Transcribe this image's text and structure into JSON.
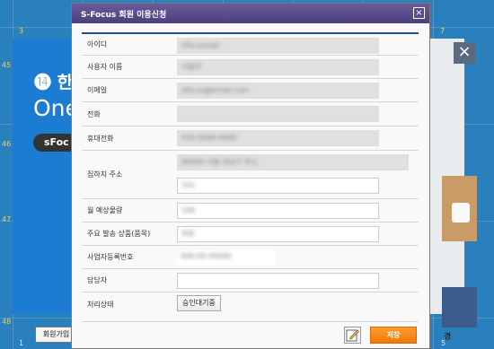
{
  "calendar": {
    "day_numbers": [
      "3",
      "7",
      "45",
      "46",
      "47",
      "48",
      "1",
      "5"
    ]
  },
  "ad": {
    "logo_text": "한",
    "headline": "One",
    "pill": "sFoc",
    "close_icon": "×",
    "join_button": "회원가입",
    "right_text": "경"
  },
  "dialog": {
    "title": "S-Focus 회원 이용신청",
    "close_icon": "×",
    "fields": {
      "userid": {
        "label": "아이디",
        "value": "sfocususer"
      },
      "username": {
        "label": "사용자 이름",
        "value": "사용자"
      },
      "email": {
        "label": "이메일",
        "value": "sfocus@email.com"
      },
      "phone": {
        "label": "전화",
        "value": ""
      },
      "mobile": {
        "label": "휴대전화",
        "value": "010-0000-0000"
      },
      "address": {
        "label": "집하지 주소",
        "value1": "00000 서울 강남구 주소",
        "value2": "101"
      },
      "monthly": {
        "label": "월 예상물량",
        "value": "100"
      },
      "product": {
        "label": "주요 발송 상품(품목)",
        "value": "의류"
      },
      "bizno": {
        "label": "사업자등록번호",
        "value": "000-00-00000"
      },
      "manager": {
        "label": "담당자",
        "value": ""
      },
      "status": {
        "label": "처리상태",
        "value": "승인대기중"
      }
    },
    "save_button": "저장"
  }
}
